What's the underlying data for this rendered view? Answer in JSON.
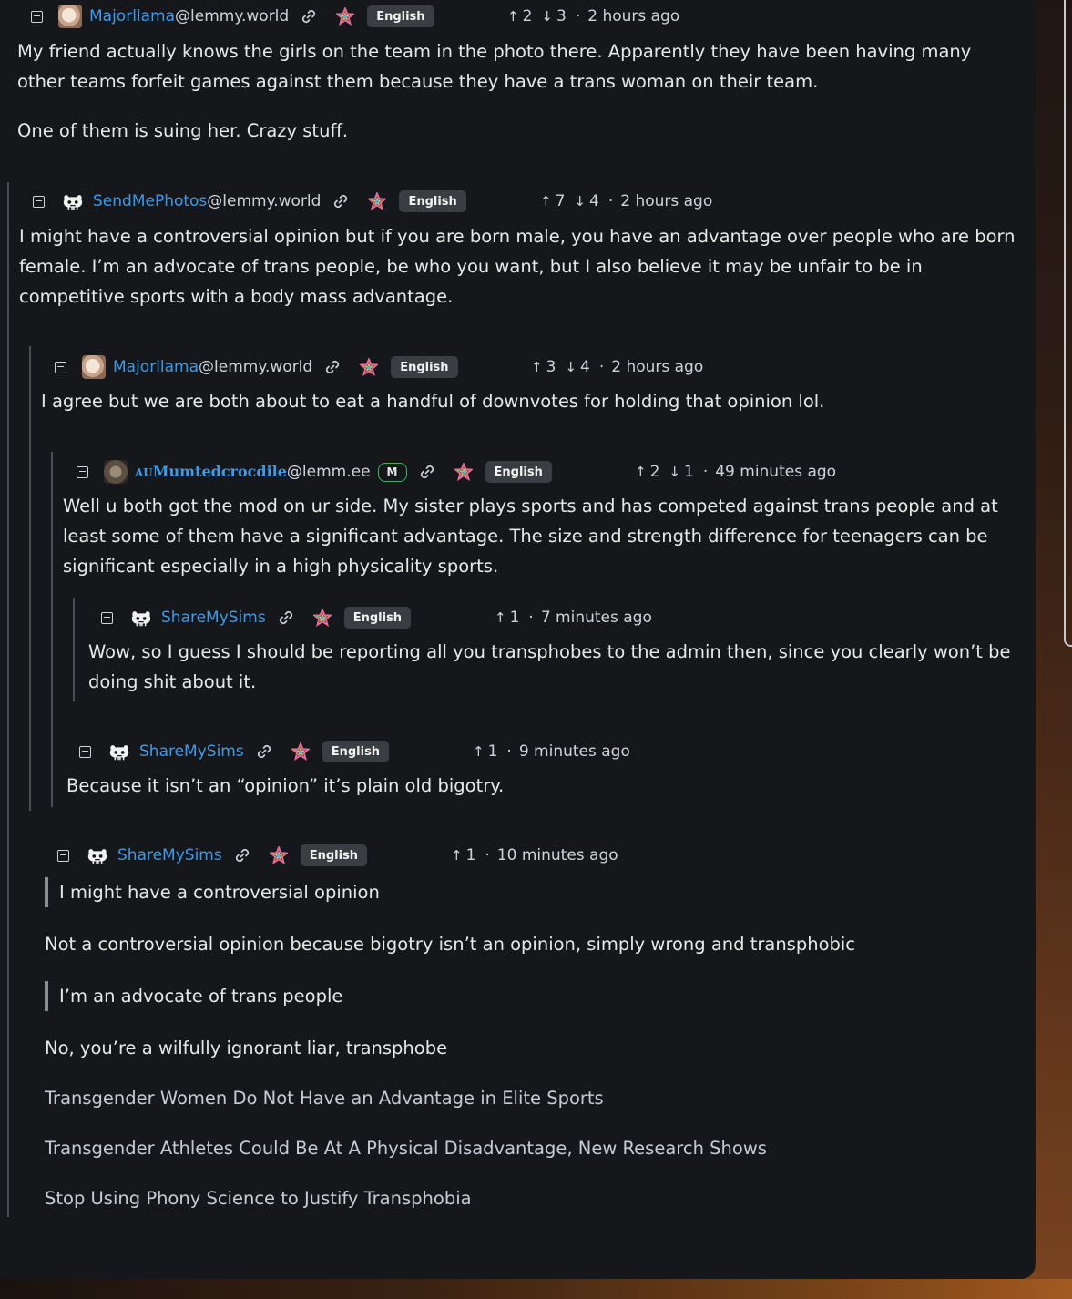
{
  "colors": {
    "panel_bg": "#16171b",
    "username": "#3d9ae8",
    "instance": "#cfd3d7",
    "text": "#e8e8e8",
    "link_text": "#c6ccd2",
    "language_badge_bg": "#3a3d42",
    "mod_badge_border": "#3fb06c",
    "thread_line": "#4a4d52"
  },
  "comments": [
    {
      "id": "c1",
      "avatar": "llama-avatar",
      "username": "Majorllama",
      "instance": "@lemmy.world",
      "language": "English",
      "upvotes": "2",
      "downvotes": "3",
      "time": "2 hours ago",
      "body": [
        "My friend actually knows the girls on the team in the photo there. Apparently they have been having many other teams forfeit games against them because they have a trans woman on their team.",
        "One of them is suing her. Crazy stuff."
      ]
    },
    {
      "id": "c2",
      "avatar": "lemmy-avatar",
      "username": "SendMePhotos",
      "instance": "@lemmy.world",
      "language": "English",
      "upvotes": "7",
      "downvotes": "4",
      "time": "2 hours ago",
      "body": [
        "I might have a controversial opinion but if you are born male, you have an advantage over people who are born female. I’m an advocate of trans people, be who you want, but I also believe it may be unfair to be in competitive sports with a body mass advantage."
      ]
    },
    {
      "id": "c3",
      "avatar": "llama-avatar",
      "username": "Majorllama",
      "instance": "@lemmy.world",
      "language": "English",
      "upvotes": "3",
      "downvotes": "4",
      "time": "2 hours ago",
      "body": [
        "I agree but we are both about to eat a handful of downvotes for holding that opinion lol."
      ]
    },
    {
      "id": "c4",
      "avatar": "croc-avatar",
      "username_prefix": "AU",
      "username": "Mumtedcrocdile",
      "instance": "@lemm.ee",
      "mod_badge": "M",
      "language": "English",
      "upvotes": "2",
      "downvotes": "1",
      "time": "49 minutes ago",
      "body": [
        "Well u both got the mod on ur side. My sister plays sports and has competed against trans people and at least some of them have a significant advantage. The size and strength difference for teenagers can be significant especially in a high physicality sports."
      ]
    },
    {
      "id": "c5",
      "avatar": "lemmy-avatar",
      "username": "ShareMySims",
      "language": "English",
      "upvotes": "1",
      "time": "7 minutes ago",
      "body": [
        "Wow, so I guess I should be reporting all you transphobes to the admin then, since you clearly won’t be doing shit about it."
      ]
    },
    {
      "id": "c6",
      "avatar": "lemmy-avatar",
      "username": "ShareMySims",
      "language": "English",
      "upvotes": "1",
      "time": "9 minutes ago",
      "body": [
        "Because it isn’t an “opinion” it’s plain old bigotry."
      ]
    },
    {
      "id": "c7",
      "avatar": "lemmy-avatar",
      "username": "ShareMySims",
      "language": "English",
      "upvotes": "1",
      "time": "10 minutes ago",
      "quote1": "I might have a controversial opinion",
      "reply1": "Not a controversial opinion because bigotry isn’t an opinion, simply wrong and transphobic",
      "quote2": "I’m an advocate of trans people",
      "reply2": "No, you’re a wilfully ignorant liar, transphobe",
      "links": [
        "Transgender Women Do Not Have an Advantage in Elite Sports",
        "Transgender Athletes Could Be At A Physical Disadvantage, New Research Shows",
        "Stop Using Phony Science to Justify Transphobia"
      ]
    }
  ]
}
